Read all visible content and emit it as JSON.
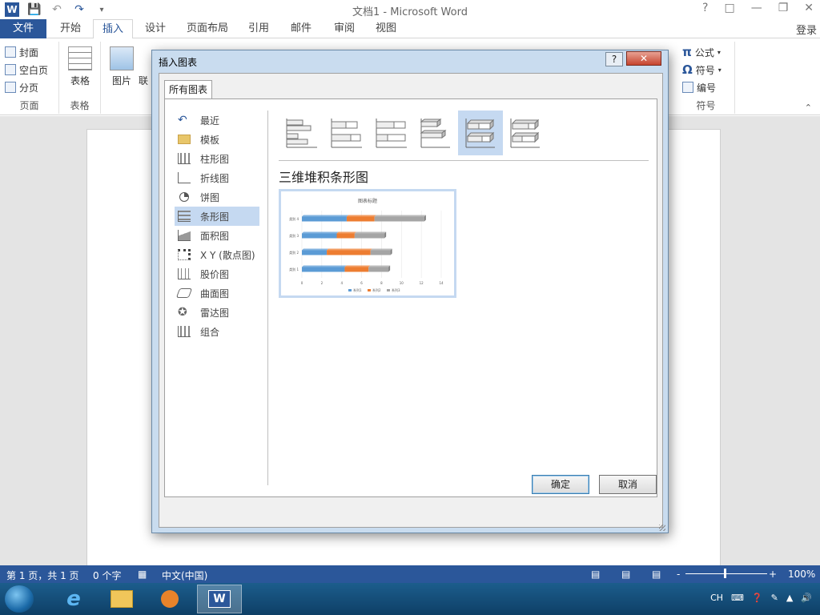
{
  "window": {
    "title": "文档1 - Microsoft Word",
    "help": "?",
    "login": "登录"
  },
  "ribbon": {
    "tabs": [
      "文件",
      "开始",
      "插入",
      "设计",
      "页面布局",
      "引用",
      "邮件",
      "审阅",
      "视图"
    ],
    "active_tab": "插入",
    "pages_group": {
      "cover": "封面",
      "blank": "空白页",
      "break": "分页",
      "label": "页面"
    },
    "table_group": {
      "table": "表格",
      "label": "表格"
    },
    "illus": {
      "picture": "图片",
      "online": "联"
    },
    "symbols_group": {
      "equation": "公式",
      "symbol": "符号",
      "number": "编号",
      "label": "符号"
    }
  },
  "dialog": {
    "title": "插入图表",
    "help": "?",
    "close": "✕",
    "tab": "所有图表",
    "categories": [
      "最近",
      "模板",
      "柱形图",
      "折线图",
      "饼图",
      "条形图",
      "面积图",
      "X Y (散点图)",
      "股价图",
      "曲面图",
      "雷达图",
      "组合"
    ],
    "selected_category": "条形图",
    "selected_subtype_index": 4,
    "type_title": "三维堆积条形图",
    "ok": "确定",
    "cancel": "取消",
    "preview": {
      "chart_title": "图表标题",
      "categories": [
        "类别 1",
        "类别 2",
        "类别 3",
        "类别 4"
      ],
      "series": [
        {
          "name": "系列1",
          "values": [
            4.3,
            2.5,
            3.5,
            4.5
          ],
          "color": "#5b9bd5"
        },
        {
          "name": "系列2",
          "values": [
            2.4,
            4.4,
            1.8,
            2.8
          ],
          "color": "#ed7d31"
        },
        {
          "name": "系列3",
          "values": [
            2.0,
            2.0,
            3.0,
            5.0
          ],
          "color": "#a5a5a5"
        }
      ],
      "xticks": [
        "0",
        "2",
        "4",
        "6",
        "8",
        "10",
        "12",
        "14"
      ],
      "xlim": [
        0,
        14
      ]
    }
  },
  "status": {
    "page": "第 1 页，共 1 页",
    "words": "0 个字",
    "lang": "中文(中国)",
    "zoom": "100%",
    "zoom_minus": "-",
    "zoom_plus": "+"
  },
  "taskbar": {
    "tray_lang": "CH"
  },
  "colors": {
    "accent": "#2b579a",
    "selected": "#c5d9f1"
  }
}
